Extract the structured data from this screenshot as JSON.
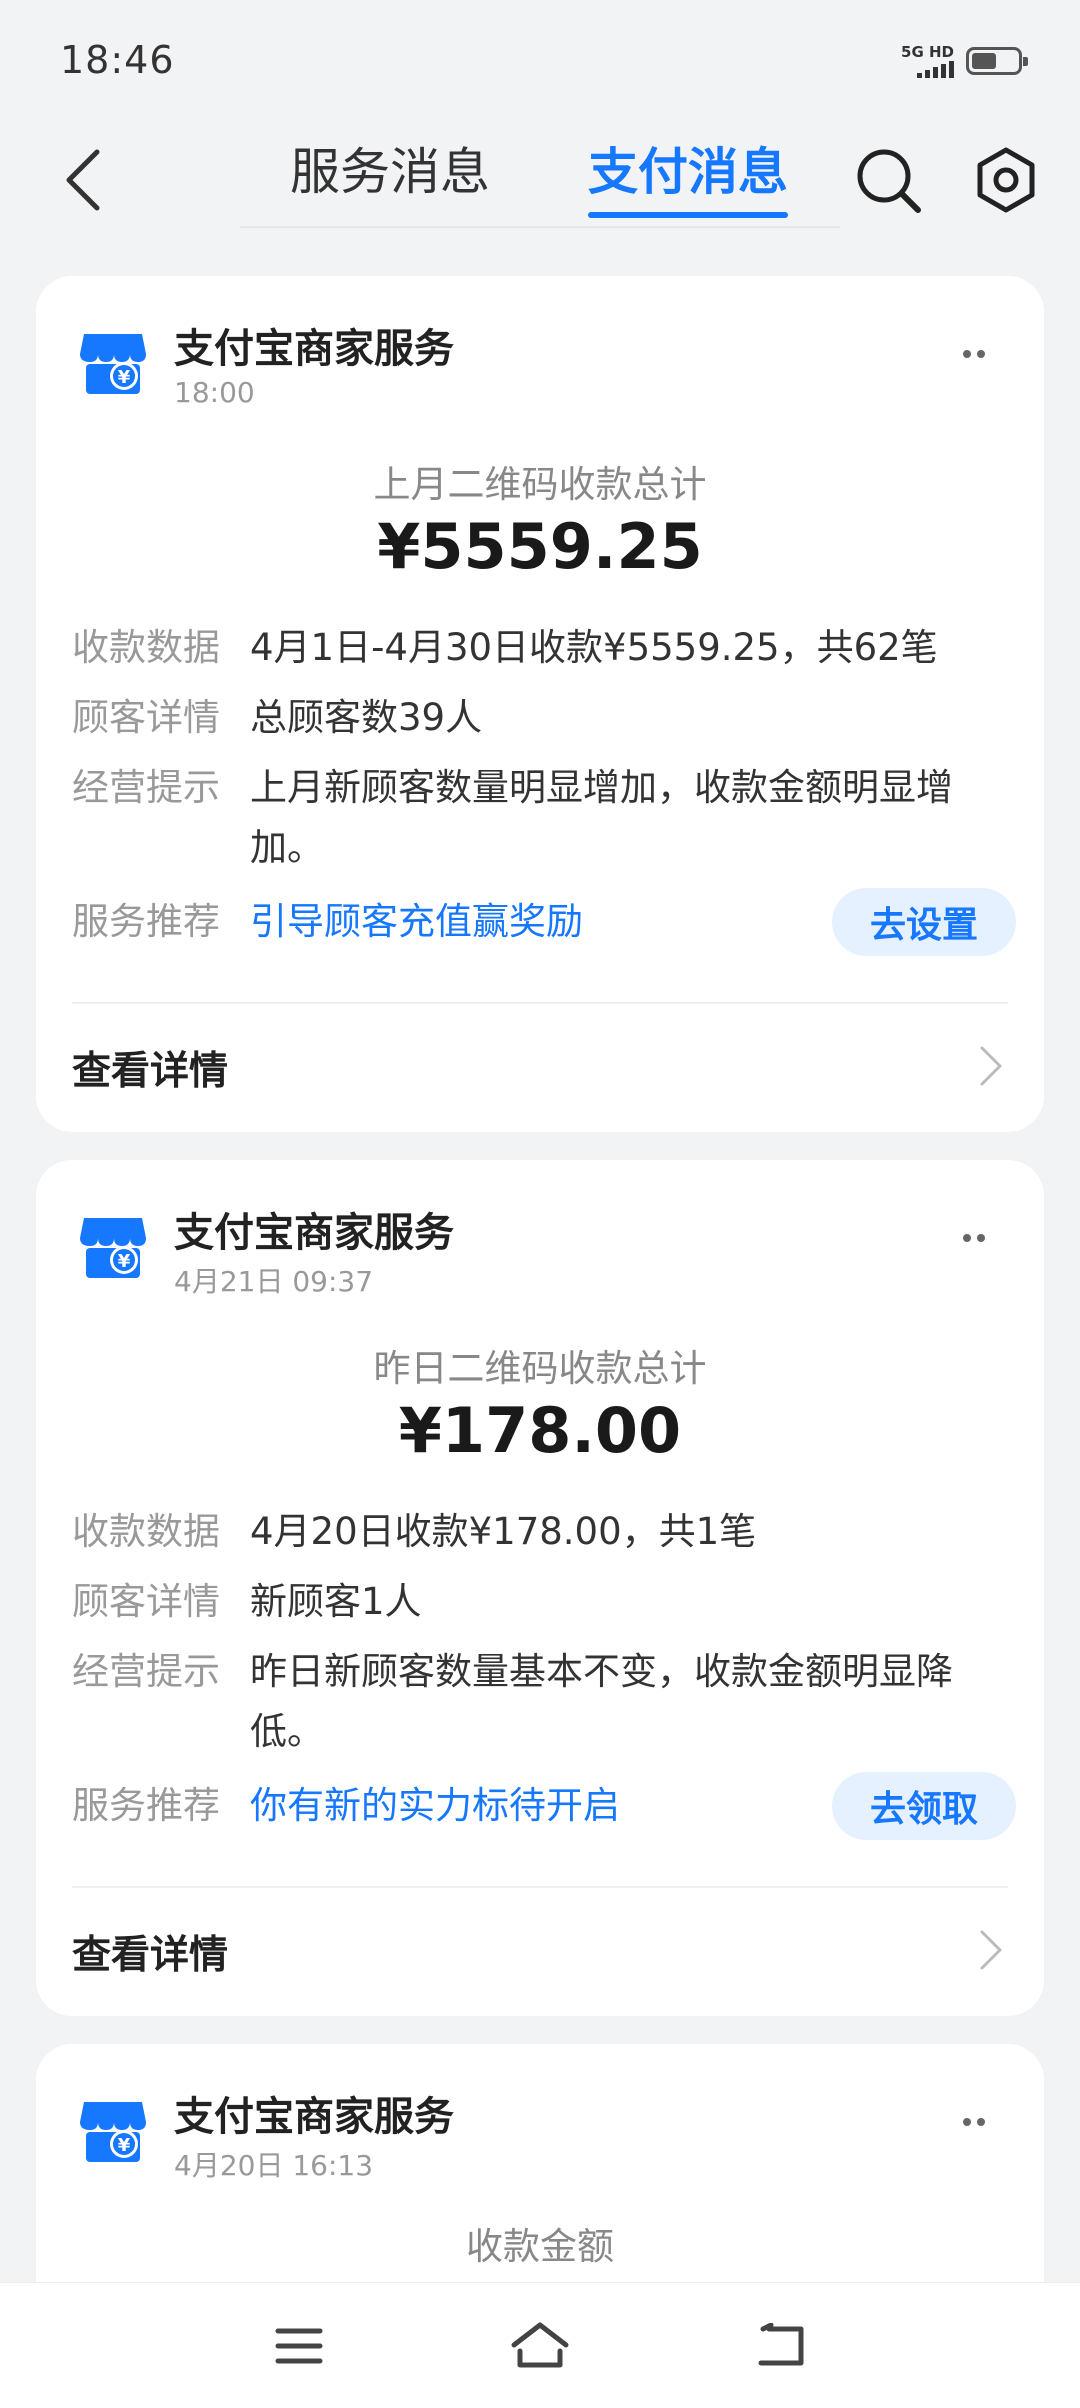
{
  "status_bar": {
    "time": "18:46",
    "network_label": "5G HD"
  },
  "header": {
    "tabs": [
      {
        "label": "服务消息",
        "active": false
      },
      {
        "label": "支付消息",
        "active": true
      }
    ]
  },
  "colors": {
    "accent": "#1677ff",
    "pill_bg": "#e6f1ff",
    "background": "#f2f3f5"
  },
  "icons": {
    "back": "chevron-left-icon",
    "search": "search-icon",
    "settings": "gear-icon",
    "merchant": "store-icon",
    "more": "more-dots-icon",
    "detail": "chevron-right-icon",
    "menu": "menu-icon",
    "home": "home-icon",
    "back_nav": "return-icon"
  },
  "messages": [
    {
      "sender": "支付宝商家服务",
      "time": "18:00",
      "summary_label": "上月二维码收款总计",
      "summary_amount": "¥5559.25",
      "rows": {
        "data_label": "收款数据",
        "data_value": "4月1日-4月30日收款¥5559.25，共62笔",
        "customer_label": "顾客详情",
        "customer_value": "总顾客数39人",
        "tip_label": "经营提示",
        "tip_value": "上月新顾客数量明显增加，收款金额明显增加。",
        "service_label": "服务推荐",
        "service_link": "引导顾客充值赢奖励",
        "service_button": "去设置"
      },
      "detail_label": "查看详情"
    },
    {
      "sender": "支付宝商家服务",
      "time": "4月21日 09:37",
      "summary_label": "昨日二维码收款总计",
      "summary_amount": "¥178.00",
      "rows": {
        "data_label": "收款数据",
        "data_value": "4月20日收款¥178.00，共1笔",
        "customer_label": "顾客详情",
        "customer_value": "新顾客1人",
        "tip_label": "经营提示",
        "tip_value": "昨日新顾客数量基本不变，收款金额明显降低。",
        "service_label": "服务推荐",
        "service_link": "你有新的实力标待开启",
        "service_button": "去领取"
      },
      "detail_label": "查看详情"
    },
    {
      "sender": "支付宝商家服务",
      "time": "4月20日 16:13",
      "summary_label": "收款金额"
    }
  ]
}
